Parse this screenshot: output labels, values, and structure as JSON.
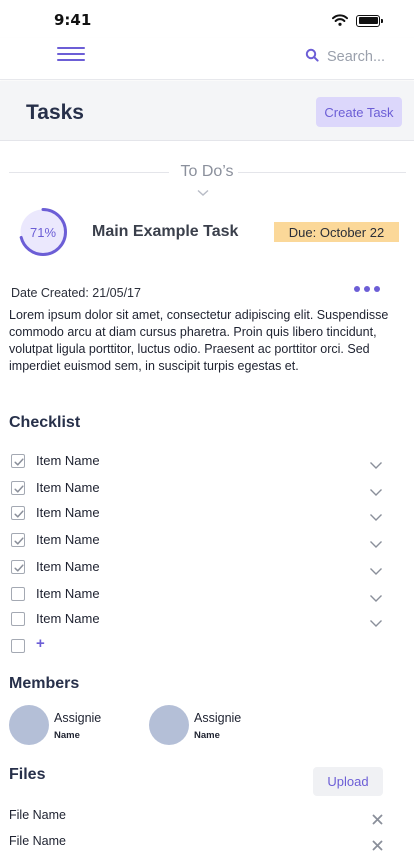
{
  "status_bar": {
    "time": "9:41",
    "icons": [
      "wifi-icon",
      "battery-icon"
    ]
  },
  "app_bar": {
    "menu_icon": "hamburger-icon",
    "search_icon": "search-icon",
    "search_label": "Search..."
  },
  "header": {
    "title": "Tasks",
    "create_button": "Create Task"
  },
  "section": {
    "label": "To Do’s"
  },
  "task": {
    "progress_text": "71%",
    "progress_value": 0.71,
    "title": "Main Example Task",
    "due": "Due: October 22",
    "date_created": "Date Created: 21/05/17",
    "description": "Lorem ipsum dolor sit amet, consectetur adipiscing elit. Suspendisse commodo arcu at diam cursus pharetra. Proin quis libero tincidunt, volutpat ligula porttitor, luctus odio. Praesent ac porttitor orci. Sed imperdiet euismod sem, in suscipit turpis egestas et."
  },
  "checklist": {
    "heading": "Checklist",
    "items": [
      {
        "label": "Item Name",
        "checked": true
      },
      {
        "label": "Item Name",
        "checked": true
      },
      {
        "label": "Item Name",
        "checked": true
      },
      {
        "label": "Item Name",
        "checked": true
      },
      {
        "label": "Item Name",
        "checked": true
      },
      {
        "label": "Item Name",
        "checked": false
      },
      {
        "label": "Item Name",
        "checked": false
      }
    ],
    "add_symbol": "+"
  },
  "members": {
    "heading": "Members",
    "items": [
      {
        "role": "Assignie",
        "name": "Name"
      },
      {
        "role": "Assignie",
        "name": "Name"
      }
    ]
  },
  "files": {
    "heading": "Files",
    "upload_button": "Upload",
    "items": [
      {
        "name": "File Name"
      },
      {
        "name": "File Name"
      }
    ]
  },
  "colors": {
    "accent": "#6c5ed6",
    "accent_light": "#dcd7fb",
    "due_badge": "#fbd899",
    "avatar": "#b4bfd7",
    "header_band": "#f4f5f7"
  }
}
